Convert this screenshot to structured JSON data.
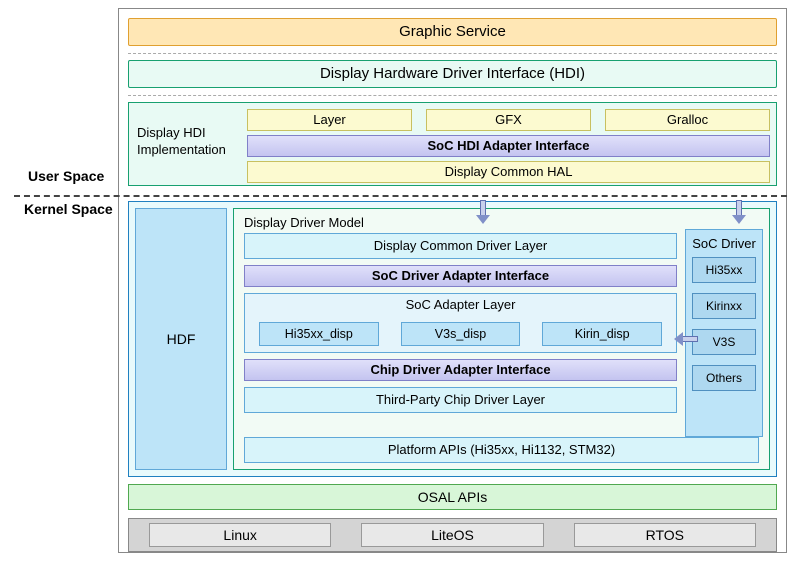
{
  "labels": {
    "user_space": "User Space",
    "kernel_space": "Kernel Space"
  },
  "top": {
    "graphic_service": "Graphic Service",
    "hdi": "Display Hardware Driver Interface (HDI)"
  },
  "hdi_impl": {
    "title_l1": "Display HDI",
    "title_l2": "Implementation",
    "modules": {
      "layer": "Layer",
      "gfx": "GFX",
      "gralloc": "Gralloc"
    },
    "soc_adapter": "SoC HDI Adapter Interface",
    "common_hal": "Display Common HAL"
  },
  "kernel": {
    "hdf": "HDF",
    "model_title": "Display Driver Model",
    "common_driver": "Display Common Driver Layer",
    "soc_driver_adapter": "SoC Driver Adapter Interface",
    "soc_adapter_layer": "SoC Adapter Layer",
    "soc_disps": {
      "a": "Hi35xx_disp",
      "b": "V3s_disp",
      "c": "Kirin_disp"
    },
    "chip_driver_adapter": "Chip Driver Adapter Interface",
    "third_party": "Third-Party Chip Driver Layer",
    "platform_apis": "Platform APIs (Hi35xx, Hi1132, STM32)",
    "soc_driver": {
      "title": "SoC Driver",
      "chips": {
        "a": "Hi35xx",
        "b": "Kirinxx",
        "c": "V3S",
        "d": "Others"
      }
    }
  },
  "osal": "OSAL APIs",
  "os": {
    "linux": "Linux",
    "liteos": "LiteOS",
    "rtos": "RTOS"
  }
}
